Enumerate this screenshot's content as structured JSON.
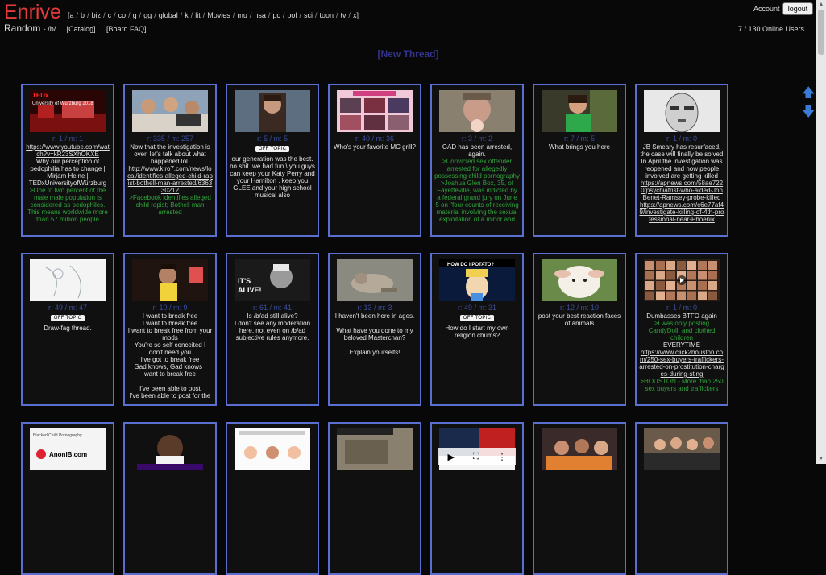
{
  "site": {
    "title": "Enrive"
  },
  "boards": [
    "a",
    "b",
    "biz",
    "c",
    "co",
    "g",
    "gg",
    "global",
    "k",
    "lit",
    "Movies",
    "mu",
    "nsa",
    "pc",
    "pol",
    "sci",
    "toon",
    "tv",
    "x"
  ],
  "nav": {
    "open": "[",
    "close": "]",
    "sep": "/"
  },
  "subnav": {
    "current": "Random",
    "board_code": "- /b/",
    "catalog": "[Catalog]",
    "faq": "[Board FAQ]"
  },
  "account": {
    "label": "Account",
    "logout": "logout",
    "online": "7 / 130 Online Users"
  },
  "new_thread": "[New Thread]",
  "threads": [
    {
      "meta": "r: 1 / m: 1",
      "tag": "",
      "text": "",
      "link": "https://www.youtube.com/watch?v=kR23SXhOKXE",
      "text2": "Why our perception of pedophilia has to change | Mirjam Heine | TEDxUniversityofWürzburg",
      "green": ">One to two percent of the male male population is considered as pedophiles. This means worldwide more than 57 million people",
      "link2": "",
      "text3": "",
      "green2": ""
    },
    {
      "meta": "r: 335 / m: 257",
      "tag": "",
      "text": "Now that the investigation is over, let's talk about what happened lol.",
      "link": "http://www.kiro7.com/news/local/identifies-alleged-child-rapist-bothell-man-arrested/636330212",
      "text2": "",
      "green": ">Facebook identifies alleged child rapist; Bothell man arrested",
      "link2": "",
      "text3": "",
      "green2": ""
    },
    {
      "meta": "r: 5 / m: 5",
      "tag": "OFF TOPIC",
      "text": "our generation was the best. no shit. we had fun.\\ you guys can keep your Katy Perry and your Hamilton . keep you GLEE and your high school musical also",
      "link": "",
      "text2": "",
      "green": "",
      "link2": "",
      "text3": "",
      "green2": ""
    },
    {
      "meta": "r: 40 / m: 36",
      "tag": "",
      "text": "Who's your favorite MC grill?",
      "link": "",
      "text2": "",
      "green": "",
      "link2": "",
      "text3": "",
      "green2": ""
    },
    {
      "meta": "r: 3 / m: 2",
      "tag": "",
      "text": "GAD has been arrested, again.",
      "link": "",
      "text2": "",
      "green": ">Convicted sex offender arrested for allegedly possessing child pornography >Joshua Glen Box, 35, of Fayetteville, was indicted by a federal grand jury on June 5 on \"four counts of receiving material involving the sexual exploitation of a minor and",
      "link2": "",
      "text3": "",
      "green2": ""
    },
    {
      "meta": "r: 7 / m: 5",
      "tag": "",
      "text": "What brings you here",
      "link": "",
      "text2": "",
      "green": "",
      "link2": "",
      "text3": "",
      "green2": ""
    },
    {
      "meta": "r: 1 / m: 0",
      "tag": "",
      "text": "JB Smeary has resurfaced, the case will finally be solved In April the investigation was reopened and now people involved are getting killed",
      "link": "https://apnews.com/58ae7220/psychiatrist-who-aided-JonBenet-Ramsey-probe-killed",
      "text2": "",
      "green": "",
      "link2": "https://apnews.com/c6e77af49/investigate-killing-of-4th-professional-near-Phoenix",
      "text3": "",
      "green2": ""
    },
    {
      "meta": "r: 49 / m: 47",
      "tag": "OFF TOPIC",
      "text": "Draw-fag thread.",
      "link": "",
      "text2": "",
      "green": "",
      "link2": "",
      "text3": "",
      "green2": ""
    },
    {
      "meta": "r: 10 / m: 9",
      "tag": "",
      "text": "I want to break free\nI want to break free\nI want to break free from your mods\nYou're so self conceited I don't need you\nI've got to break free\nGad knows, Gad knows I want to break free\n\nI've been able to post\nI've been able to post for the",
      "link": "",
      "text2": "",
      "green": "",
      "link2": "",
      "text3": "",
      "green2": ""
    },
    {
      "meta": "r: 61 / m: 41",
      "tag": "",
      "text": "Is /b/ad still alive?\nI don't see any moderation here, not even on /b/ad subjective rules anymore.",
      "link": "",
      "text2": "",
      "green": "",
      "link2": "",
      "text3": "",
      "green2": ""
    },
    {
      "meta": "r: 13 / m: 3",
      "tag": "",
      "text": "I haven't been here in ages.\n\nWhat have you done to my beloved Masterchan?\n\nExplain yourselfs!",
      "link": "",
      "text2": "",
      "green": "",
      "link2": "",
      "text3": "",
      "green2": ""
    },
    {
      "meta": "r: 49 / m: 31",
      "tag": "OFF TOPIC",
      "text": "How do I start my own religion chums?",
      "link": "",
      "text2": "",
      "green": "",
      "link2": "",
      "text3": "",
      "green2": ""
    },
    {
      "meta": "r: 12 / m: 10",
      "tag": "",
      "text": "post your best reaction faces of animals",
      "link": "",
      "text2": "",
      "green": "",
      "link2": "",
      "text3": "",
      "green2": ""
    },
    {
      "meta": "r: 1 / m: 0",
      "tag": "",
      "text": "Dumbasses BTFO again",
      "link": "",
      "text2": "",
      "green": ">I was only posting CandyDoll, and clothed children",
      "link2": "https://www.click2houston.com/250-sex-buyers-traffickers-arrested-on-prostitution-charges-during-sting",
      "text3": "EVERYTIME",
      "green2": ">HOUSTON - More than 250 sex buyers and traffickers"
    }
  ],
  "thumbs": {
    "t0": "TEDx University of Würzburg 2018",
    "t18": "HOW DO I POTATO?",
    "t9": "IT'S ALIVE!",
    "t14": "AnonIB.com"
  },
  "colors": {
    "accent": "#e53b3b",
    "card_border": "#5b6fd1",
    "greentext": "#2fa33a",
    "meta": "#3a4e9a"
  }
}
